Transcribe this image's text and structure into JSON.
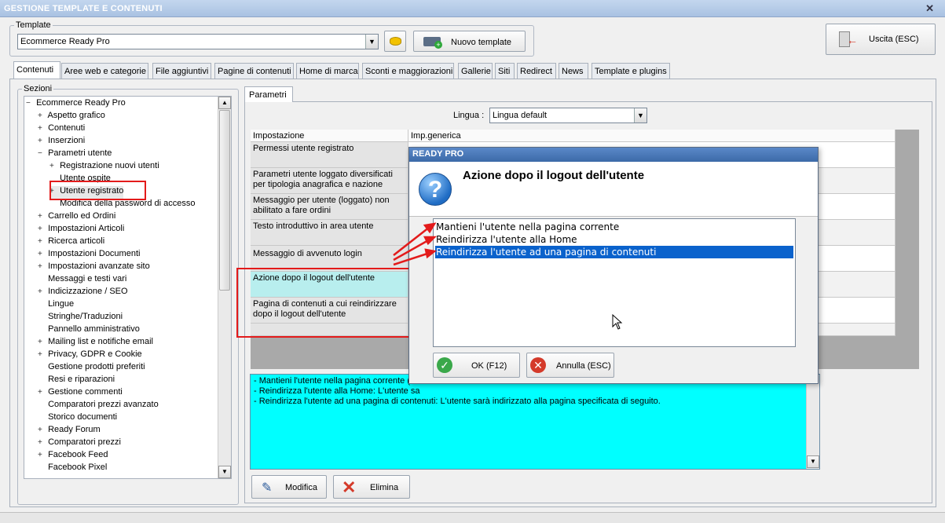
{
  "window": {
    "title": "GESTIONE TEMPLATE E CONTENUTI"
  },
  "template": {
    "group_label": "Template",
    "selected": "Ecommerce Ready Pro",
    "new_button": "Nuovo template"
  },
  "exit_button": "Uscita (ESC)",
  "tabs": [
    {
      "label": "Contenuti",
      "active": true
    },
    {
      "label": "Aree web e categorie"
    },
    {
      "label": "File aggiuntivi"
    },
    {
      "label": "Pagine di contenuti"
    },
    {
      "label": "Home di marca"
    },
    {
      "label": "Sconti e maggiorazioni"
    },
    {
      "label": "Gallerie"
    },
    {
      "label": "Siti"
    },
    {
      "label": "Redirect"
    },
    {
      "label": "News"
    },
    {
      "label": "Template e plugins"
    }
  ],
  "sections": {
    "label": "Sezioni",
    "items": [
      {
        "label": "Ecommerce Ready Pro",
        "prefix": "−"
      },
      {
        "label": "Aspetto grafico",
        "prefix": "+"
      },
      {
        "label": "Contenuti",
        "prefix": "+"
      },
      {
        "label": "Inserzioni",
        "prefix": "+"
      },
      {
        "label": "Parametri utente",
        "prefix": "−"
      },
      {
        "label": "Registrazione nuovi utenti",
        "prefix": "+"
      },
      {
        "label": "Utente ospite",
        "prefix": ""
      },
      {
        "label": "Utente registrato",
        "prefix": "+"
      },
      {
        "label": "Modifica della password di accesso",
        "prefix": ""
      },
      {
        "label": "Carrello ed Ordini",
        "prefix": "+"
      },
      {
        "label": "Impostazioni Articoli",
        "prefix": "+"
      },
      {
        "label": "Ricerca articoli",
        "prefix": "+"
      },
      {
        "label": "Impostazioni Documenti",
        "prefix": "+"
      },
      {
        "label": "Impostazioni avanzate sito",
        "prefix": "+"
      },
      {
        "label": "Messaggi e testi vari",
        "prefix": ""
      },
      {
        "label": "Indicizzazione / SEO",
        "prefix": "+"
      },
      {
        "label": "Lingue",
        "prefix": ""
      },
      {
        "label": "Stringhe/Traduzioni",
        "prefix": ""
      },
      {
        "label": "Pannello amministrativo",
        "prefix": ""
      },
      {
        "label": "Mailing list e notifiche email",
        "prefix": "+"
      },
      {
        "label": "Privacy, GDPR e Cookie",
        "prefix": "+"
      },
      {
        "label": "Gestione prodotti preferiti",
        "prefix": ""
      },
      {
        "label": "Resi e riparazioni",
        "prefix": ""
      },
      {
        "label": "Gestione commenti",
        "prefix": "+"
      },
      {
        "label": "Comparatori prezzi avanzato",
        "prefix": ""
      },
      {
        "label": "Storico documenti",
        "prefix": ""
      },
      {
        "label": "Ready Forum",
        "prefix": "+"
      },
      {
        "label": "Comparatori prezzi",
        "prefix": "+"
      },
      {
        "label": "Facebook Feed",
        "prefix": "+"
      },
      {
        "label": "Facebook Pixel",
        "prefix": ""
      }
    ]
  },
  "params": {
    "tab_label": "Parametri",
    "lingua_label": "Lingua :",
    "lingua_value": "Lingua default",
    "col_setting": "Impostazione",
    "col_value": "Imp.generica",
    "rows": [
      "Permessi utente registrato",
      "Parametri utente loggato diversificati per tipologia anagrafica e nazione",
      "Messaggio per utente (loggato) non abilitato a fare ordini",
      "Testo introduttivo in area utente",
      "Messaggio di avvenuto login",
      "Azione dopo il logout dell'utente",
      "Pagina di contenuti a cui reindirizzare dopo il logout dell'utente"
    ]
  },
  "info_lines": [
    "- Mantieni l'utente nella pagina corrente (d",
    "- Reindirizza l'utente alla Home: L'utente sa",
    "- Reindirizza l'utente ad una pagina di contenuti: L'utente sarà indirizzato alla pagina specificata di seguito."
  ],
  "buttons": {
    "modify": "Modifica",
    "delete": "Elimina"
  },
  "dialog": {
    "title": "READY PRO",
    "heading": "Azione dopo il logout dell'utente",
    "options": [
      "Mantieni l'utente nella pagina corrente",
      "Reindirizza l'utente alla Home",
      "Reindirizza l'utente ad una pagina di contenuti"
    ],
    "selected_index": 2,
    "ok": "OK (F12)",
    "cancel": "Annulla (ESC)"
  },
  "colors": {
    "highlight": "#e31b1b",
    "selection": "#0a62cc",
    "info_bg": "#00ffff"
  }
}
